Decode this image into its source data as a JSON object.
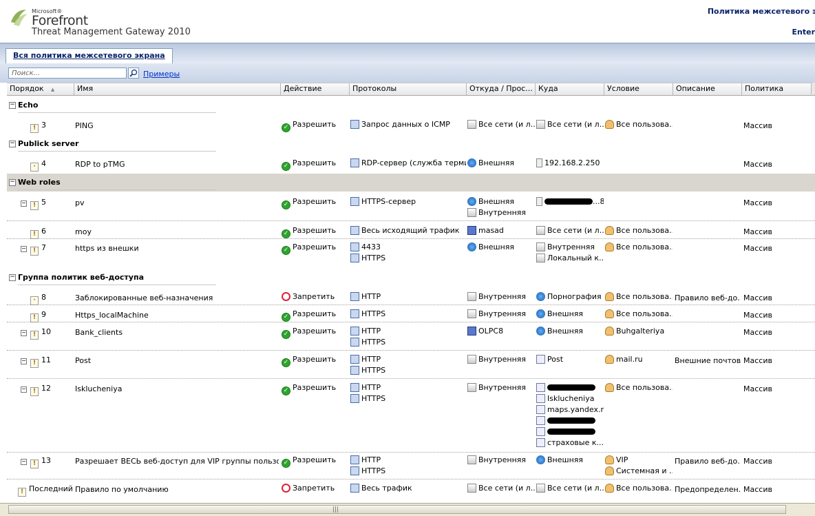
{
  "app": {
    "vendor": "Microsoft®",
    "product": "Forefront",
    "edition": "Threat Management Gateway 2010",
    "header_right_title": "Политика межсетевого эк",
    "header_right_sub": "Enter"
  },
  "tab": {
    "label": "Вся политика межсетевого экрана"
  },
  "toolbar": {
    "search_placeholder": "Поиск...",
    "samples_link": "Примеры"
  },
  "columns": [
    "Порядок",
    "Имя",
    "Действие",
    "Протоколы",
    "Откуда / Прос...",
    "Куда",
    "Условие",
    "Описание",
    "Политика"
  ],
  "groups": [
    {
      "name": "Echo"
    },
    {
      "name": "Publick server"
    },
    {
      "name": "Web roles"
    },
    {
      "name": "Группа политик веб-доступа"
    }
  ],
  "rules": [
    {
      "order": "3",
      "name": "PING",
      "action": "Разрешить",
      "action_type": "allow",
      "protocols": [
        "Запрос данных о ICMP"
      ],
      "from": [
        "Все сети (и л..."
      ],
      "to": [
        "Все сети (и л..."
      ],
      "condition": [
        "Все пользова..."
      ],
      "description": "",
      "policy": "Массив"
    },
    {
      "order": "4",
      "name": "RDP to pTMG",
      "action": "Разрешить",
      "action_type": "allow",
      "protocols": [
        "RDP-сервер (служба терми..."
      ],
      "from": [
        "Внешняя"
      ],
      "to": [
        "192.168.2.250"
      ],
      "condition": [],
      "description": "",
      "policy": "Массив"
    },
    {
      "order": "5",
      "name": "pv",
      "action": "Разрешить",
      "action_type": "allow",
      "protocols": [
        "HTTPS-сервер"
      ],
      "from": [
        "Внешняя",
        "Внутренняя"
      ],
      "to": [
        "...8"
      ],
      "condition": [],
      "description": "",
      "policy": "Массив"
    },
    {
      "order": "6",
      "name": "moy",
      "action": "Разрешить",
      "action_type": "allow",
      "protocols": [
        "Весь исходящий трафик"
      ],
      "from": [
        "masad"
      ],
      "to": [
        "Все сети (и л..."
      ],
      "condition": [
        "Все пользова..."
      ],
      "description": "",
      "policy": "Массив"
    },
    {
      "order": "7",
      "name": "https из внешки",
      "action": "Разрешить",
      "action_type": "allow",
      "protocols": [
        "4433",
        "HTTPS"
      ],
      "from": [
        "Внешняя"
      ],
      "to": [
        "Внутренняя",
        "Локальный к..."
      ],
      "condition": [
        "Все пользова..."
      ],
      "description": "",
      "policy": "Массив"
    },
    {
      "order": "8",
      "name": "Заблокированные веб-назначения",
      "action": "Запретить",
      "action_type": "deny",
      "protocols": [
        "HTTP"
      ],
      "from": [
        "Внутренняя"
      ],
      "to": [
        "Порнография"
      ],
      "condition": [
        "Все пользова..."
      ],
      "description": "Правило веб-до...",
      "policy": "Массив"
    },
    {
      "order": "9",
      "name": "Https_localMachine",
      "action": "Разрешить",
      "action_type": "allow",
      "protocols": [
        "HTTPS"
      ],
      "from": [
        "Внутренняя"
      ],
      "to": [
        "Внешняя"
      ],
      "condition": [
        "Все пользова..."
      ],
      "description": "",
      "policy": "Массив"
    },
    {
      "order": "10",
      "name": "Bank_clients",
      "action": "Разрешить",
      "action_type": "allow",
      "protocols": [
        "HTTP",
        "HTTPS"
      ],
      "from": [
        "OLPC8"
      ],
      "to": [
        "Внешняя"
      ],
      "condition": [
        "Buhgalteriya"
      ],
      "description": "",
      "policy": "Массив"
    },
    {
      "order": "11",
      "name": "Post",
      "action": "Разрешить",
      "action_type": "allow",
      "protocols": [
        "HTTP",
        "HTTPS"
      ],
      "from": [
        "Внутренняя"
      ],
      "to": [
        "Post"
      ],
      "condition": [
        "mail.ru"
      ],
      "description": "Внешние почтов...",
      "policy": "Массив"
    },
    {
      "order": "12",
      "name": "Isklucheniya",
      "action": "Разрешить",
      "action_type": "allow",
      "protocols": [
        "HTTP",
        "HTTPS"
      ],
      "from": [
        "Внутренняя"
      ],
      "to": [
        "",
        "Isklucheniya",
        "maps.yandex.ru",
        "",
        "",
        "страховые к..."
      ],
      "condition": [
        "Все пользова..."
      ],
      "description": "",
      "policy": "Массив"
    },
    {
      "order": "13",
      "name": "Разрешает ВЕСЬ веб-доступ для VIP группы пользоват...",
      "action": "Разрешить",
      "action_type": "allow",
      "protocols": [
        "HTTP",
        "HTTPS"
      ],
      "from": [
        "Внутренняя"
      ],
      "to": [
        "Внешняя"
      ],
      "condition": [
        "VIP",
        "Системная и ..."
      ],
      "description": "Правило веб-до...",
      "policy": "Массив"
    },
    {
      "order": "Последний",
      "name": "Правило по умолчанию",
      "action": "Запретить",
      "action_type": "deny",
      "protocols": [
        "Весь трафик"
      ],
      "from": [
        "Все сети (и л..."
      ],
      "to": [
        "Все сети (и л..."
      ],
      "condition": [
        "Все пользова..."
      ],
      "description": "Предопределен...",
      "policy": "Массив"
    }
  ]
}
